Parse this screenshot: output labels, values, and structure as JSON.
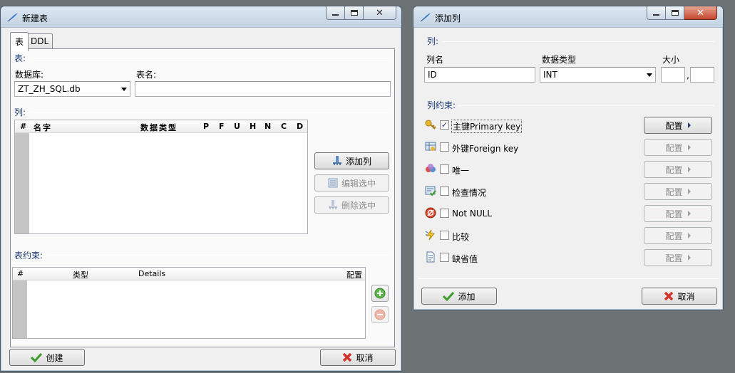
{
  "new_table": {
    "title": "新建表",
    "tabs": [
      {
        "label": "表"
      },
      {
        "label": "DDL"
      }
    ],
    "table_section": "表:",
    "database_label": "数据库:",
    "database_value": "ZT_ZH_SQL.db",
    "table_name_label": "表名:",
    "table_name_value": "",
    "columns_section": "列:",
    "columns_headers": [
      "#",
      "名字",
      "数据类型",
      "P",
      "F",
      "U",
      "H",
      "N",
      "C",
      "D"
    ],
    "add_column": "添加列",
    "edit_selected": "编辑选中",
    "delete_selected": "删除选中",
    "constraints_section": "表约束:",
    "constraints_headers": [
      "#",
      "类型",
      "Details",
      "配置"
    ],
    "create": "创建",
    "cancel": "取消"
  },
  "add_column": {
    "title": "添加列",
    "column_section": "列:",
    "col_name_label": "列名",
    "col_name_value": "ID",
    "data_type_label": "数据类型",
    "data_type_value": "INT",
    "size_label": "大小",
    "size_sep": ",",
    "constraints_section": "列约束:",
    "constraints": [
      {
        "label": "主键Primary key",
        "checked": true,
        "enabled": true,
        "icon": "key-icon"
      },
      {
        "label": "外键Foreign key",
        "checked": false,
        "enabled": false,
        "icon": "foreign-key-icon"
      },
      {
        "label": "唯一",
        "checked": false,
        "enabled": false,
        "icon": "unique-icon"
      },
      {
        "label": "检查情况",
        "checked": false,
        "enabled": false,
        "icon": "check-condition-icon"
      },
      {
        "label": "Not NULL",
        "checked": false,
        "enabled": false,
        "icon": "not-null-icon"
      },
      {
        "label": "比较",
        "checked": false,
        "enabled": false,
        "icon": "collate-icon"
      },
      {
        "label": "缺省值",
        "checked": false,
        "enabled": false,
        "icon": "default-value-icon"
      }
    ],
    "configure": "配置",
    "add": "添加",
    "cancel": "取消"
  },
  "colors": {
    "accent": "#1d3a78",
    "ok_green": "#3c9a2a",
    "cancel_red": "#d2332a"
  }
}
